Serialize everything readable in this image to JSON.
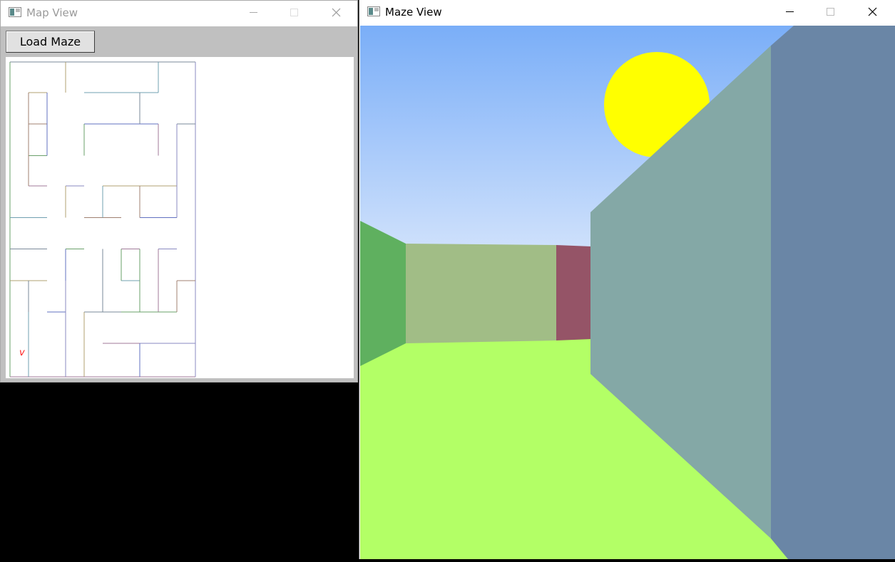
{
  "map_window": {
    "title": "Map View",
    "load_button": "Load Maze",
    "player_marker": "v",
    "colors": {
      "marker": "#ff2020",
      "title_inactive": "#9a9a9a"
    }
  },
  "maze_window": {
    "title": "Maze View",
    "colors": {
      "sky_top": "#7aaef8",
      "sky_bottom": "#f2f6fd",
      "floor": "#b3ff66",
      "sun": "#ffff00",
      "left_wall": "#5fb05f",
      "front_wall": "#a1bd86",
      "maroon_wall": "#955467",
      "right_wall_near": "#6a86a6",
      "right_wall_far": "#84a8a6"
    }
  },
  "window_controls": {
    "minimize_icon": "minimize-icon",
    "maximize_icon": "maximize-icon",
    "close_icon": "close-icon"
  }
}
